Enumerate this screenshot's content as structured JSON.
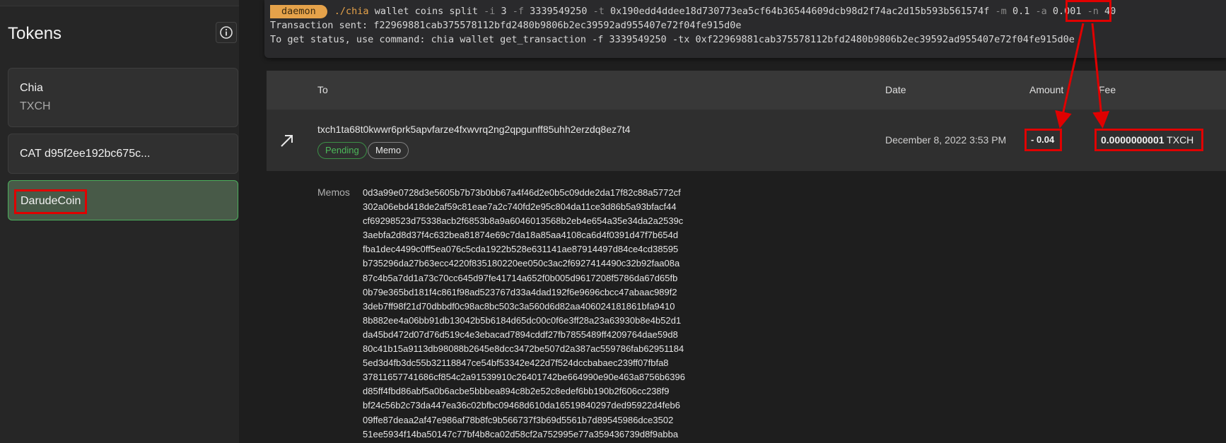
{
  "sidebar": {
    "title": "Tokens",
    "info_icon": "info-icon",
    "tokens": [
      {
        "name": "Chia",
        "symbol": "TXCH"
      },
      {
        "name": "CAT d95f2ee192bc675c..."
      },
      {
        "name": "DarudeCoin"
      }
    ]
  },
  "terminal": {
    "prompt": "daemon",
    "cmd": "./chia",
    "args1": " wallet coins split ",
    "f_i": "-i",
    "v_i": " 3 ",
    "f_f": "-f",
    "v_f": " 3339549250 ",
    "f_t": "-t",
    "v_t": " 0x190edd4ddee18d730773ea5cf64b36544609dcb98d2f74ac2d15b593b561574f ",
    "f_m": "-m",
    "v_m": " 0.1 ",
    "f_a": "-a",
    "v_a": " 0.001 ",
    "f_n": "-n",
    "v_n": " 40",
    "line2": "Transaction sent: f22969881cab375578112bfd2480b9806b2ec39592ad955407e72f04fe915d0e",
    "line3": "To get status, use command: chia wallet get_transaction -f 3339549250 -tx 0xf22969881cab375578112bfd2480b9806b2ec39592ad955407e72f04fe915d0e"
  },
  "table": {
    "headers": {
      "to": "To",
      "date": "Date",
      "amount": "Amount",
      "fee": "Fee"
    },
    "row": {
      "address": "txch1ta68t0kwwr6prk5apvfarze4fxwvrq2ng2qpgunff85uhh2erzdq8ez7t4",
      "status": "Pending",
      "memo_badge": "Memo",
      "date": "December 8, 2022 3:53 PM",
      "amount": "- 0.04",
      "fee_value": "0.0000000001",
      "fee_unit": " TXCH"
    }
  },
  "memos": {
    "label": "Memos",
    "lines": [
      "0d3a99e0728d3e5605b7b73b0bb67a4f46d2e0b5c09dde2da17f82c88a5772cf",
      "302a06ebd418de2af59c81eae7a2c740fd2e95c804da11ce3d86b5a93bfacf44",
      "cf69298523d75338acb2f6853b8a9a6046013568b2eb4e654a35e34da2a2539c",
      "3aebfa2d8d37f4c632bea81874e69c7da18a85aa4108ca6d4f0391d47f7b654d",
      "fba1dec4499c0ff5ea076c5cda1922b528e631141ae87914497d84ce4cd38595",
      "b735296da27b63ecc4220f835180220ee050c3ac2f6927414490c32b92faa08a",
      "87c4b5a7dd1a73c70cc645d97fe41714a652f0b005d9617208f5786da67d65fb",
      "0b79e365bd181f4c861f98ad523767d33a4dad192f6e9696cbcc47abaac989f2",
      "3deb7ff98f21d70dbbdf0c98ac8bc503c3a560d6d82aa406024181861bfa9410",
      "8b882ee4a06bb91db13042b5b6184d65dc00c0f6e3ff28a23a63930b8e4b52d1",
      "da45bd472d07d76d519c4e3ebacad7894cddf27fb7855489ff4209764dae59d8",
      "80c41b15a9113db98088b2645e8dcc3472be507d2a387ac559786fab62951184",
      "5ed3d4fb3dc55b32118847ce54bf53342e422d7f524dccbabaec239ff07fbfa8",
      "37811657741686cf854c2a91539910c26401742be664990e90e463a8756b6396",
      "d85ff4fbd86abf5a0b6acbe5bbbea894c8b2e52c8edef6bb190b2f606cc238f9",
      "bf24c56b2c73da447ea36c02bfbc09468d610da16519840297ded95922d4feb6",
      "09ffe87deaa2af47e986af78b8fc9b566737f3b69d5561b7d89545986dce3502",
      "51ee5934f14ba50147c77bf4b8ca02d58cf2a752995e77a359436739d8f9abba"
    ]
  },
  "colors": {
    "highlight": "#e00000",
    "pending": "#4cba5a",
    "daemon": "#e5a24a"
  }
}
